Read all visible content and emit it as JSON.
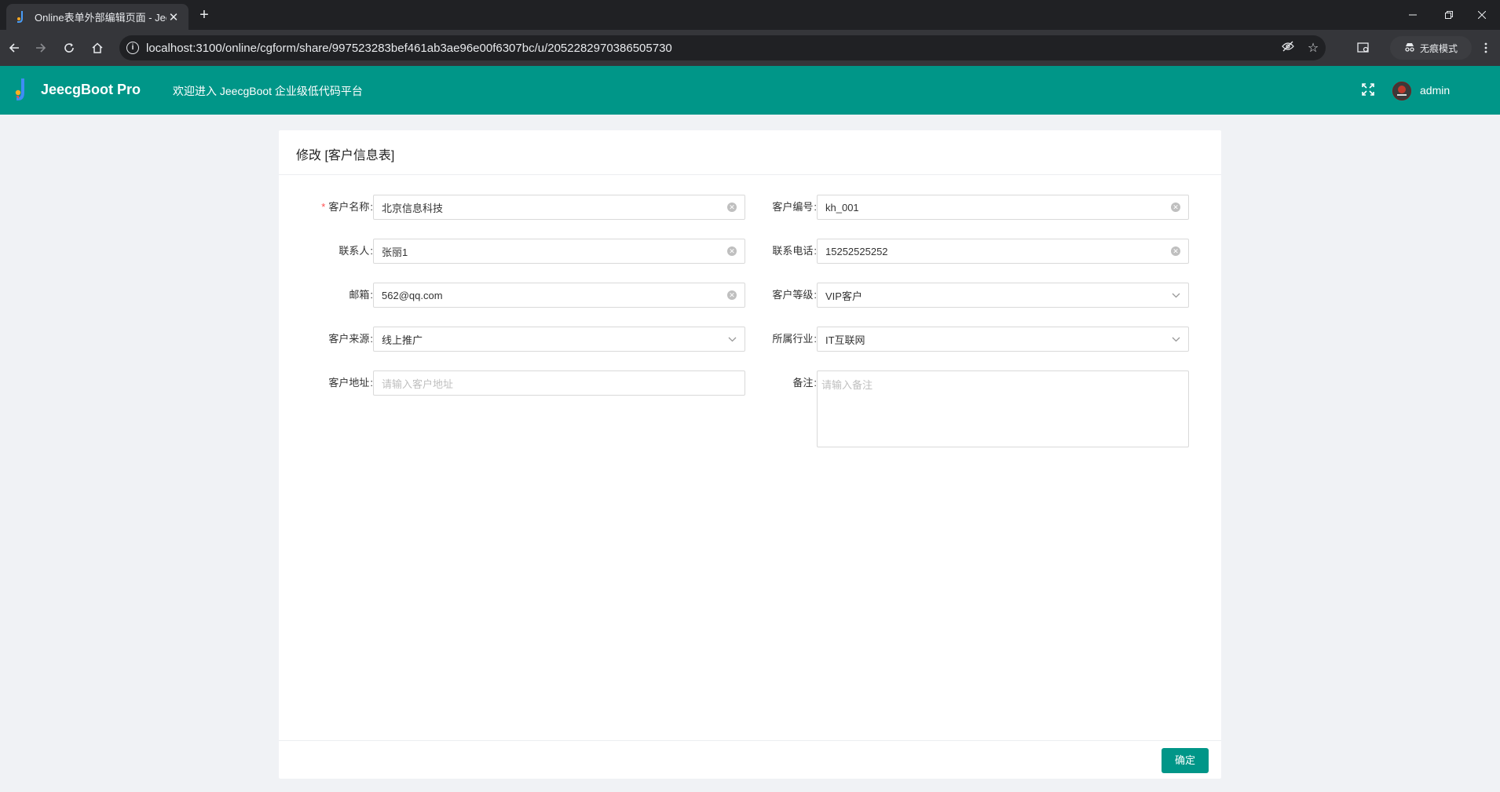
{
  "browser": {
    "tab_title": "Online表单外部编辑页面 - Jeec",
    "tab_close": "✕",
    "new_tab": "+",
    "url": "localhost:3100/online/cgform/share/997523283bef461ab3ae96e00f6307bc/u/2052282970386505730",
    "incognito_label": "无痕模式"
  },
  "header": {
    "brand": "JeecgBoot Pro",
    "welcome": "欢迎进入 JeecgBoot 企业级低代码平台",
    "username": "admin",
    "color": "#009688"
  },
  "form": {
    "title": "修改 [客户信息表]",
    "fields": {
      "customer_name": {
        "label": "客户名称",
        "value": "北京信息科技",
        "required": true
      },
      "customer_code": {
        "label": "客户编号",
        "value": "kh_001"
      },
      "contact": {
        "label": "联系人",
        "value": "张丽1"
      },
      "phone": {
        "label": "联系电话",
        "value": "15252525252"
      },
      "email": {
        "label": "邮箱",
        "value": "562@qq.com"
      },
      "level": {
        "label": "客户等级",
        "value": "VIP客户"
      },
      "source": {
        "label": "客户来源",
        "value": "线上推广"
      },
      "industry": {
        "label": "所属行业",
        "value": "IT互联网"
      },
      "address": {
        "label": "客户地址",
        "placeholder": "请输入客户地址"
      },
      "remark": {
        "label": "备注",
        "placeholder": "请输入备注"
      }
    },
    "submit_label": "确定"
  }
}
